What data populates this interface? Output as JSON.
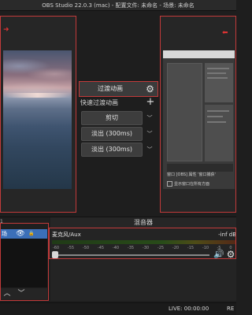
{
  "window": {
    "title": "OBS Studio 22.0.3 (mac) - 配置文件: 未命名 - 场景: 未命名"
  },
  "preview": {
    "arrow_icon": "arrow-right-icon"
  },
  "program": {
    "arrow_icon": "arrow-left-icon",
    "caption": "窗口   [OBS] 属性 '窗口捕获'",
    "checkbox_label": "显示窗口在所有方面"
  },
  "transitions": {
    "transition_button_label": "过渡动画",
    "quick_transitions_label": "快速过渡动画",
    "buttons": [
      {
        "label": "剪切"
      },
      {
        "label": "淡出 (300ms)"
      },
      {
        "label": "淡出 (300ms)"
      }
    ]
  },
  "scenes": {
    "header": "1",
    "items": [
      {
        "label": "场"
      }
    ]
  },
  "mixer": {
    "title": "混音器",
    "track": {
      "name": "麦克风/Aux",
      "level": "-inf dB",
      "volume_percent": 0
    },
    "ticks": [
      "-60",
      "-55",
      "-50",
      "-45",
      "-40",
      "-35",
      "-30",
      "-25",
      "-20",
      "-15",
      "-10",
      "-5",
      "0"
    ]
  },
  "status": {
    "live": "LIVE: 00:00:00",
    "rec": "RE"
  },
  "colors": {
    "accent_red": "#c23a3a",
    "selection_blue": "#3b6fb8"
  }
}
